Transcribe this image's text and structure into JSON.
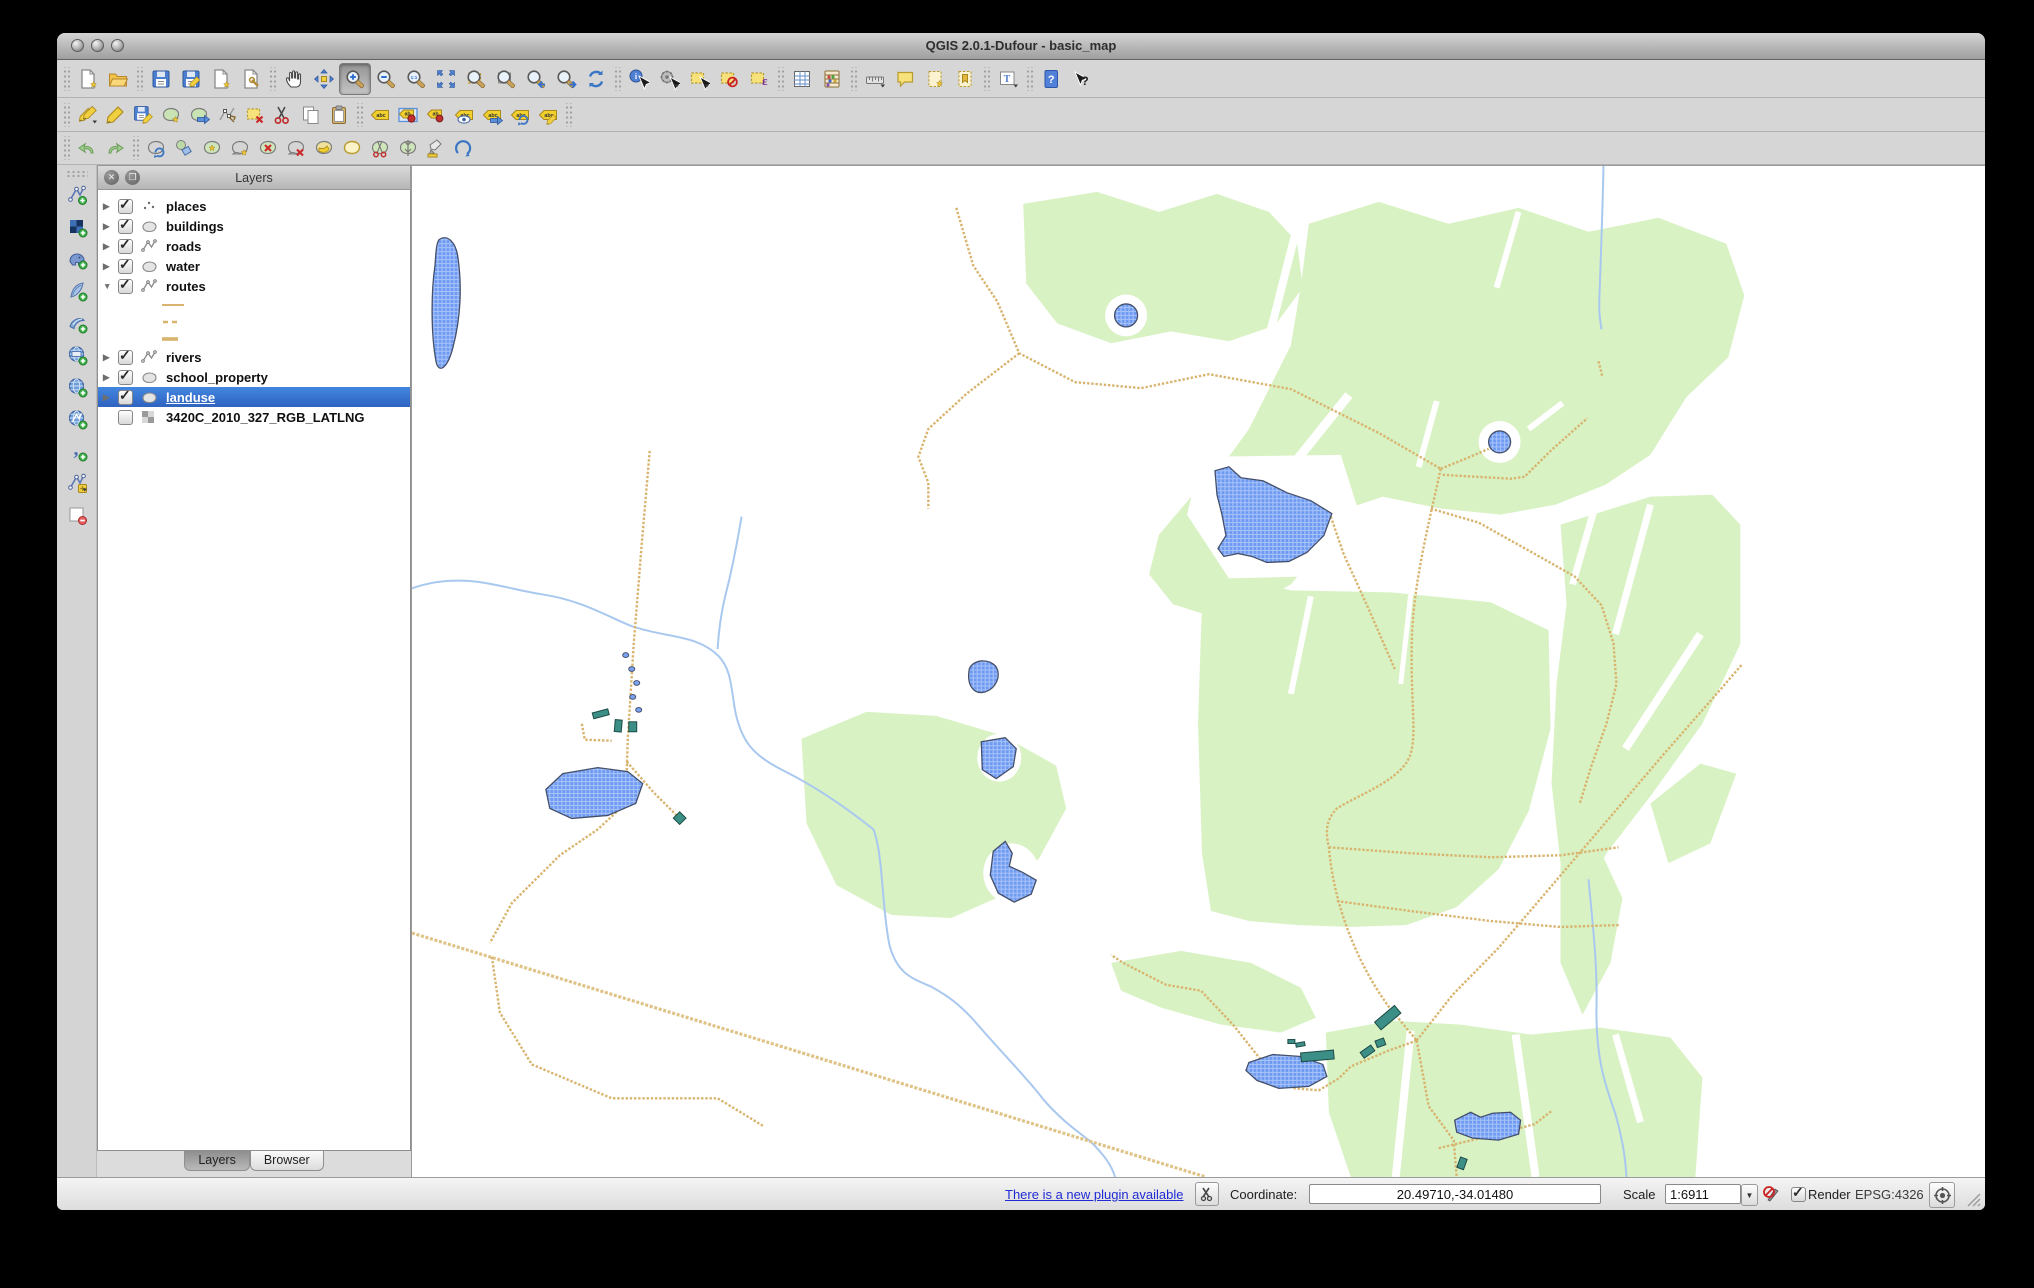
{
  "window": {
    "title": "QGIS 2.0.1-Dufour - basic_map"
  },
  "toolbars": {
    "pressed_tool": "zoom-in",
    "row1": [
      "sep",
      "file-new",
      "file-open",
      "sep",
      "file-save",
      "file-save-as",
      "new-composer",
      "composer-manager",
      "sep",
      "pan",
      "pan-to-selection",
      "zoom-in",
      "zoom-out",
      "zoom-native",
      "zoom-full",
      "zoom-selection",
      "zoom-layer",
      "zoom-last",
      "zoom-next",
      "refresh",
      "sep",
      "identify",
      "run-feature-action",
      "select-features",
      "deselect-features",
      "select-by-expression",
      "sep",
      "attribute-table",
      "field-calculator",
      "sep",
      "measure",
      "map-tips",
      "new-bookmark",
      "show-bookmarks",
      "sep",
      "text-annotation",
      "sep",
      "help",
      "whats-this"
    ],
    "row2": [
      "sep",
      "current-edits",
      "toggle-editing",
      "save-layer-edits",
      "add-feature",
      "move-feature",
      "node-tool",
      "delete-selected",
      "cut-features",
      "copy-features",
      "paste-features",
      "sep",
      "labeling",
      "pin-label",
      "unpin-label",
      "show-hide-labels",
      "move-label",
      "rotate-label",
      "change-label",
      "sep"
    ],
    "row3": [
      "sep",
      "undo",
      "redo",
      "sep",
      "rotate-feature",
      "simplify-feature",
      "add-ring",
      "add-part",
      "delete-ring",
      "delete-part",
      "fill-ring",
      "reshape-features",
      "split-features",
      "split-parts",
      "rotate-point-symbols",
      "offset-curve"
    ],
    "left": [
      "add-vector-layer",
      "add-raster-layer",
      "add-postgis-layer",
      "add-spatialite-layer",
      "add-mssql-layer",
      "add-oracle-layer",
      "add-wms-layer",
      "add-wfs-layer",
      "add-delimited-text-layer",
      "new-shapefile-layer",
      "remove-layer"
    ]
  },
  "layers_panel": {
    "title": "Layers",
    "tabs": [
      {
        "label": "Layers",
        "active": true
      },
      {
        "label": "Browser",
        "active": false
      }
    ],
    "layers": [
      {
        "label": "places",
        "checked": true,
        "expanded": false,
        "selected": false,
        "type": "point"
      },
      {
        "label": "buildings",
        "checked": true,
        "expanded": false,
        "selected": false,
        "type": "polygon"
      },
      {
        "label": "roads",
        "checked": true,
        "expanded": false,
        "selected": false,
        "type": "line"
      },
      {
        "label": "water",
        "checked": true,
        "expanded": false,
        "selected": false,
        "type": "polygon"
      },
      {
        "label": "routes",
        "checked": true,
        "expanded": true,
        "selected": false,
        "type": "line",
        "children": [
          {
            "swatch": "line-thin"
          },
          {
            "swatch": "dashes"
          },
          {
            "swatch": "line-thick"
          }
        ]
      },
      {
        "label": "rivers",
        "checked": true,
        "expanded": false,
        "selected": false,
        "type": "line"
      },
      {
        "label": "school_property",
        "checked": true,
        "expanded": false,
        "selected": false,
        "type": "polygon"
      },
      {
        "label": "landuse",
        "checked": true,
        "expanded": false,
        "selected": true,
        "type": "polygon"
      },
      {
        "label": "3420C_2010_327_RGB_LATLNG",
        "checked": false,
        "expanded": false,
        "selected": false,
        "type": "raster"
      }
    ]
  },
  "status_bar": {
    "plugin_link": "There is a new plugin available",
    "coordinate_label": "Coordinate:",
    "coordinate_value": "20.49710,-34.01480",
    "scale_label": "Scale",
    "scale_value": "1:6911",
    "render_label": "Render",
    "crs_label": "EPSG:4326"
  },
  "map": {
    "colors": {
      "landuse_green": "#d9f2c4",
      "water_blue": "#6d9af3",
      "water_hatch": "#a9c3f8",
      "water_outline": "#44506b",
      "road_tan": "#d8b46e",
      "river_blue": "#a9c8ef",
      "building_teal": "#3c8f86",
      "selection_blue": "#3a74d6"
    }
  }
}
